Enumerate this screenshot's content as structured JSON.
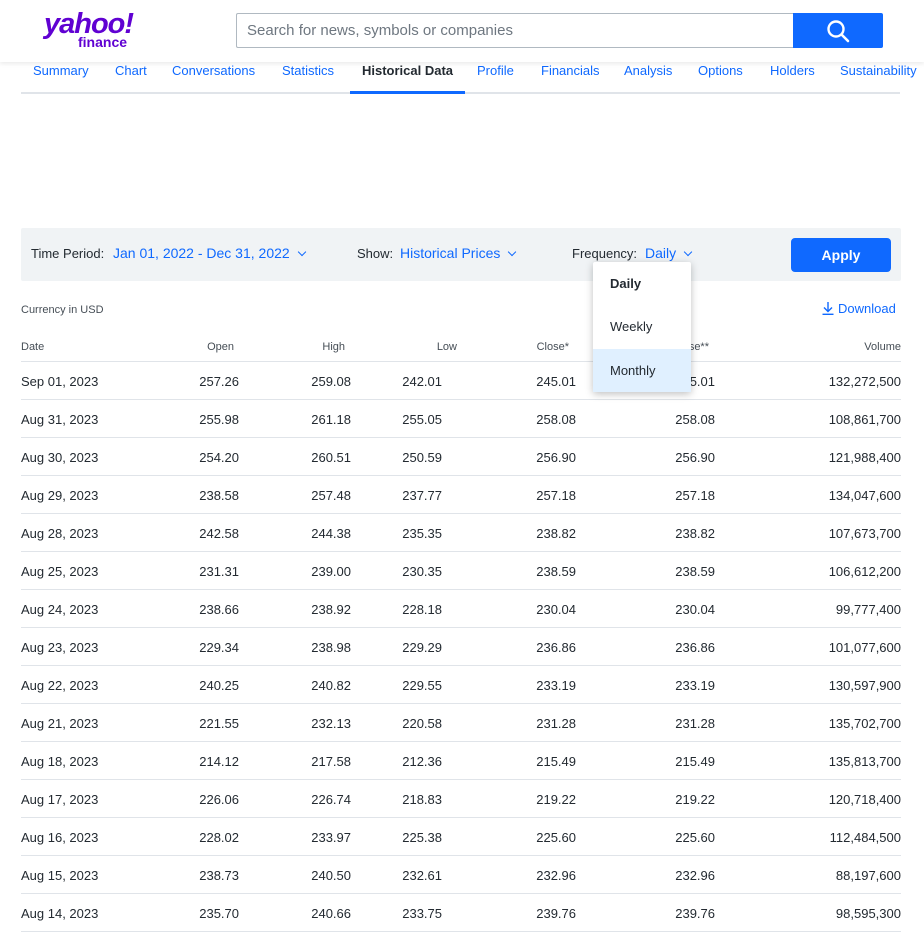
{
  "brand": {
    "word": "yahoo!",
    "sub": "finance"
  },
  "search": {
    "placeholder": "Search for news, symbols or companies"
  },
  "tabs": [
    "Summary",
    "Chart",
    "Conversations",
    "Statistics",
    "Historical Data",
    "Profile",
    "Financials",
    "Analysis",
    "Options",
    "Holders",
    "Sustainability"
  ],
  "active_tab": "Historical Data",
  "filters": {
    "time_period_label": "Time Period:",
    "time_period_value": "Jan 01, 2022 - Dec 31, 2022",
    "show_label": "Show:",
    "show_value": "Historical Prices",
    "frequency_label": "Frequency:",
    "frequency_value": "Daily",
    "apply_label": "Apply"
  },
  "frequency_options": [
    "Daily",
    "Weekly",
    "Monthly"
  ],
  "currency_note": "Currency in USD",
  "download_label": "Download",
  "columns": [
    "Date",
    "Open",
    "High",
    "Low",
    "Close*",
    "se**",
    "Volume"
  ],
  "rows": [
    [
      "Sep 01, 2023",
      "257.26",
      "259.08",
      "242.01",
      "245.01",
      "5.01",
      "132,272,500"
    ],
    [
      "Aug 31, 2023",
      "255.98",
      "261.18",
      "255.05",
      "258.08",
      "258.08",
      "108,861,700"
    ],
    [
      "Aug 30, 2023",
      "254.20",
      "260.51",
      "250.59",
      "256.90",
      "256.90",
      "121,988,400"
    ],
    [
      "Aug 29, 2023",
      "238.58",
      "257.48",
      "237.77",
      "257.18",
      "257.18",
      "134,047,600"
    ],
    [
      "Aug 28, 2023",
      "242.58",
      "244.38",
      "235.35",
      "238.82",
      "238.82",
      "107,673,700"
    ],
    [
      "Aug 25, 2023",
      "231.31",
      "239.00",
      "230.35",
      "238.59",
      "238.59",
      "106,612,200"
    ],
    [
      "Aug 24, 2023",
      "238.66",
      "238.92",
      "228.18",
      "230.04",
      "230.04",
      "99,777,400"
    ],
    [
      "Aug 23, 2023",
      "229.34",
      "238.98",
      "229.29",
      "236.86",
      "236.86",
      "101,077,600"
    ],
    [
      "Aug 22, 2023",
      "240.25",
      "240.82",
      "229.55",
      "233.19",
      "233.19",
      "130,597,900"
    ],
    [
      "Aug 21, 2023",
      "221.55",
      "232.13",
      "220.58",
      "231.28",
      "231.28",
      "135,702,700"
    ],
    [
      "Aug 18, 2023",
      "214.12",
      "217.58",
      "212.36",
      "215.49",
      "215.49",
      "135,813,700"
    ],
    [
      "Aug 17, 2023",
      "226.06",
      "226.74",
      "218.83",
      "219.22",
      "219.22",
      "120,718,400"
    ],
    [
      "Aug 16, 2023",
      "228.02",
      "233.97",
      "225.38",
      "225.60",
      "225.60",
      "112,484,500"
    ],
    [
      "Aug 15, 2023",
      "238.73",
      "240.50",
      "232.61",
      "232.96",
      "232.96",
      "88,197,600"
    ],
    [
      "Aug 14, 2023",
      "235.70",
      "240.66",
      "233.75",
      "239.76",
      "239.76",
      "98,595,300"
    ]
  ],
  "colors": {
    "accent": "#0f69ff",
    "brand": "#6001d2",
    "text": "#232a31"
  },
  "icons": [
    "search-icon",
    "chevron-down-icon",
    "download-icon"
  ]
}
